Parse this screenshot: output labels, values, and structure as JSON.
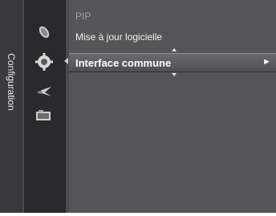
{
  "sidebar": {
    "title": "Configuration"
  },
  "icons": [
    {
      "name": "satellite-dish-icon"
    },
    {
      "name": "settings-gear-icon"
    },
    {
      "name": "input-connector-icon"
    },
    {
      "name": "application-icon"
    }
  ],
  "menu": {
    "items": [
      {
        "label": "PIP",
        "state": "dimmed"
      },
      {
        "label": "Mise à jour logicielle",
        "state": "normal"
      },
      {
        "label": "Interface commune",
        "state": "selected"
      }
    ],
    "selected_arrow": "►"
  }
}
